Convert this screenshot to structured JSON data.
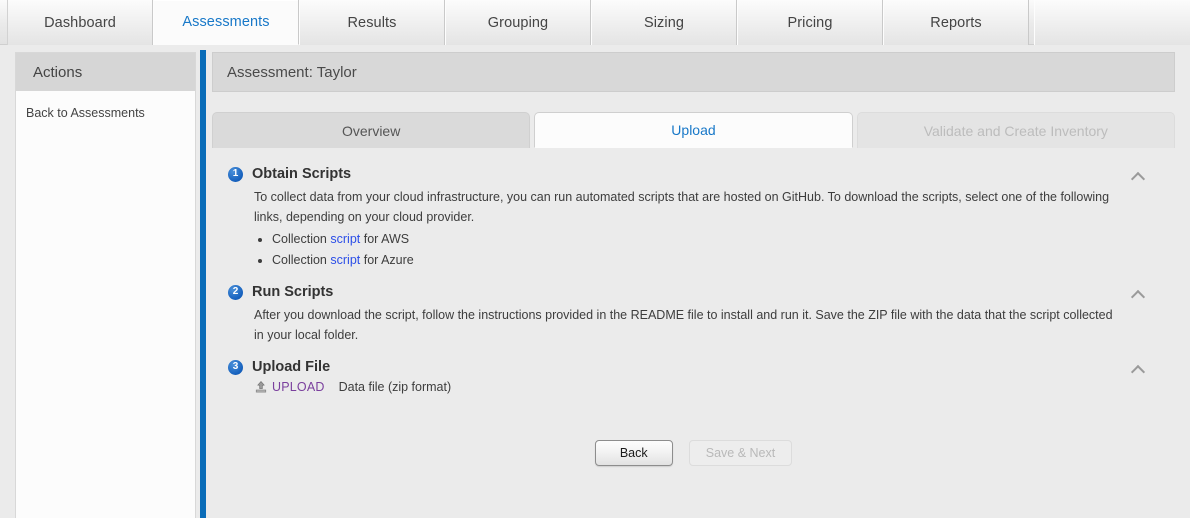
{
  "topbar": {
    "tabs": [
      {
        "label": "Dashboard",
        "active": false
      },
      {
        "label": "Assessments",
        "active": true
      },
      {
        "label": "Results",
        "active": false
      },
      {
        "label": "Grouping",
        "active": false
      },
      {
        "label": "Sizing",
        "active": false
      },
      {
        "label": "Pricing",
        "active": false
      },
      {
        "label": "Reports",
        "active": false
      }
    ]
  },
  "sidebar": {
    "header": "Actions",
    "links": [
      {
        "label": "Back to Assessments"
      }
    ]
  },
  "main": {
    "page_title": "Assessment: Taylor",
    "subtabs": [
      {
        "label": "Overview",
        "state": "normal"
      },
      {
        "label": "Upload",
        "state": "current"
      },
      {
        "label": "Validate and Create Inventory",
        "state": "disabled"
      }
    ],
    "steps": [
      {
        "number": "1",
        "title": "Obtain Scripts",
        "paragraph": "To collect data from your cloud infrastructure, you can run automated scripts that are hosted on GitHub. To download the scripts, select one of the following links, depending on your cloud provider.",
        "bullets": [
          {
            "pre": "Collection ",
            "link": "script",
            "post": " for AWS"
          },
          {
            "pre": "Collection ",
            "link": "script",
            "post": " for Azure"
          }
        ],
        "collapse_icon": "chevron-up-icon"
      },
      {
        "number": "2",
        "title": "Run Scripts",
        "paragraph": "After you download the script, follow the instructions provided in the README file to install and run it. Save the ZIP file with the data that the script collected in your local folder.",
        "collapse_icon": "chevron-up-icon"
      },
      {
        "number": "3",
        "title": "Upload File",
        "upload_icon": "upload-icon",
        "upload_link": "UPLOAD",
        "upload_note": "Data file (zip format)",
        "collapse_icon": "chevron-up-icon"
      }
    ],
    "buttons": {
      "back": "Back",
      "save_next": "Save & Next"
    }
  },
  "colors": {
    "accent_blue": "#0a6cb8",
    "tab_active_text": "#1878c8",
    "link_blue": "#2b4ee8",
    "upload_link": "#7a3f9d",
    "badge_blue": "#1565c0",
    "page_bg": "#ebebeb"
  }
}
